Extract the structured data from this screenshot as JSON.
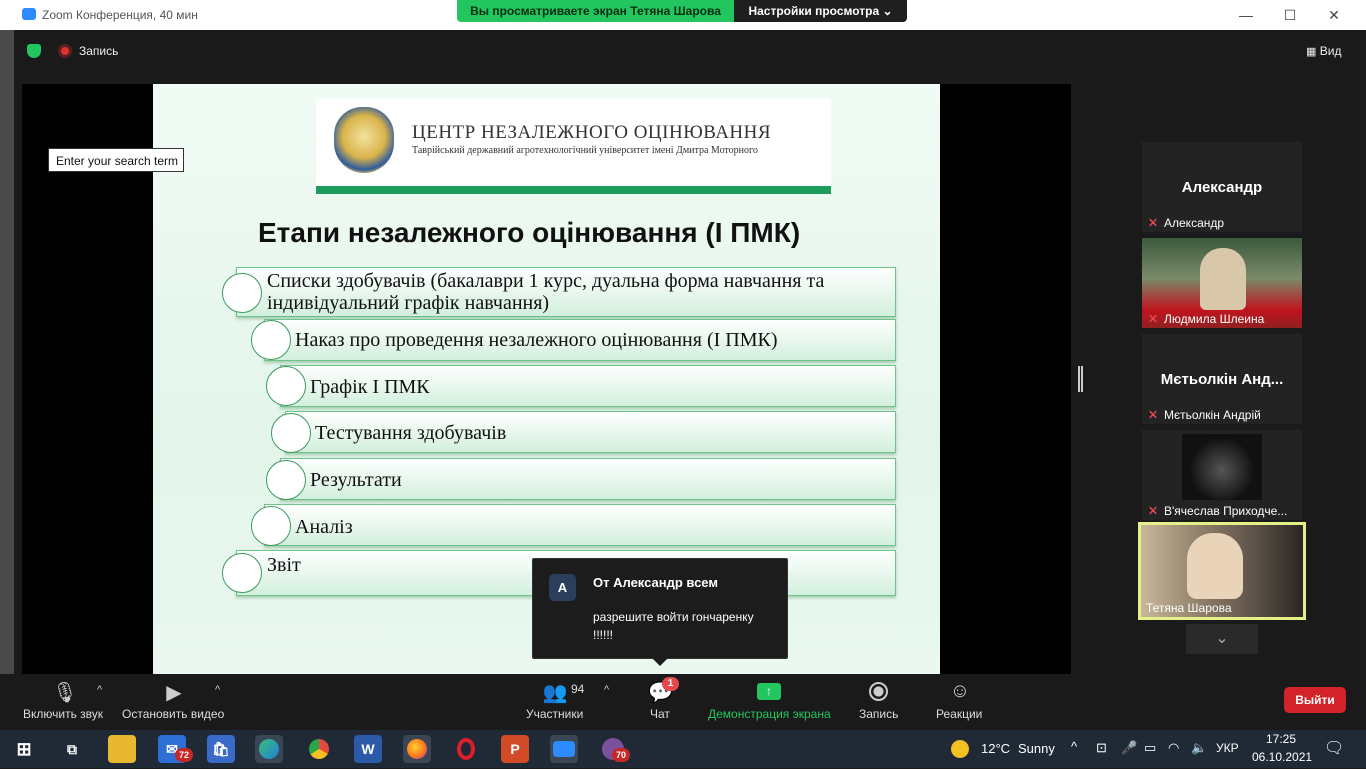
{
  "window": {
    "title": "Zoom Конференция, 40 мин",
    "minimize": "—",
    "maximize": "☐",
    "close": "✕"
  },
  "share_banner": {
    "viewing_text": "Вы просматриваете экран Тетяна Шарова",
    "view_settings_label": "Настройки просмотра",
    "view_settings_caret": "⌄"
  },
  "meeting_top": {
    "record_label": "Запись",
    "view_label": "Вид",
    "view_icon": "grid-icon"
  },
  "search_box": {
    "text": "Enter your search term"
  },
  "slide": {
    "center_title": "ЦЕНТР НЕЗАЛЕЖНОГО ОЦІНЮВАННЯ",
    "center_subtitle": "Таврійський державний агротехнологічний університет імені Дмитра Моторного",
    "title": "Етапи незалежного оцінювання (І ПМК)",
    "items": [
      "Списки здобувачів (бакалаври 1 курс, дуальна форма навчання та індивідуальний графік навчання)",
      "Наказ про проведення незалежного оцінювання (І ПМК)",
      "Графік І ПМК",
      "Тестування здобувачів",
      "Результати",
      "Аналіз",
      "Звіт"
    ]
  },
  "participants_panel": {
    "tiles": [
      {
        "big_name": "Александр",
        "name": "Александр",
        "video": false
      },
      {
        "big_name": "",
        "name": "Людмила Шлеина",
        "video": true
      },
      {
        "big_name": "Мєтьолкін Анд...",
        "name": "Мєтьолкін Андрій",
        "video": false
      },
      {
        "big_name": "",
        "name": "В'ячеслав Приходче...",
        "video": true
      }
    ],
    "active_speaker": "Тетяна Шарова",
    "scroll_down": "⌄"
  },
  "chat_popup": {
    "avatar_letter": "A",
    "from": "От Александр всем",
    "message": "разрешите войти гончаренку !!!!!!"
  },
  "toolbar": {
    "unmute_label": "Включить звук",
    "stop_video_label": "Остановить видео",
    "participants_label": "Участники",
    "participants_count": "94",
    "chat_label": "Чат",
    "chat_badge": "1",
    "share_label": "Демонстрация экрана",
    "record_label": "Запись",
    "reactions_label": "Реакции",
    "leave_label": "Выйти",
    "caret": "^",
    "colors": {
      "share": "#22c55e",
      "leave": "#d3222a"
    }
  },
  "taskbar": {
    "mail_badge": "72",
    "viber_badge": "70",
    "weather_temp": "12°C",
    "weather_text": "Sunny",
    "language": "УКР",
    "time": "17:25",
    "date": "06.10.2021"
  }
}
